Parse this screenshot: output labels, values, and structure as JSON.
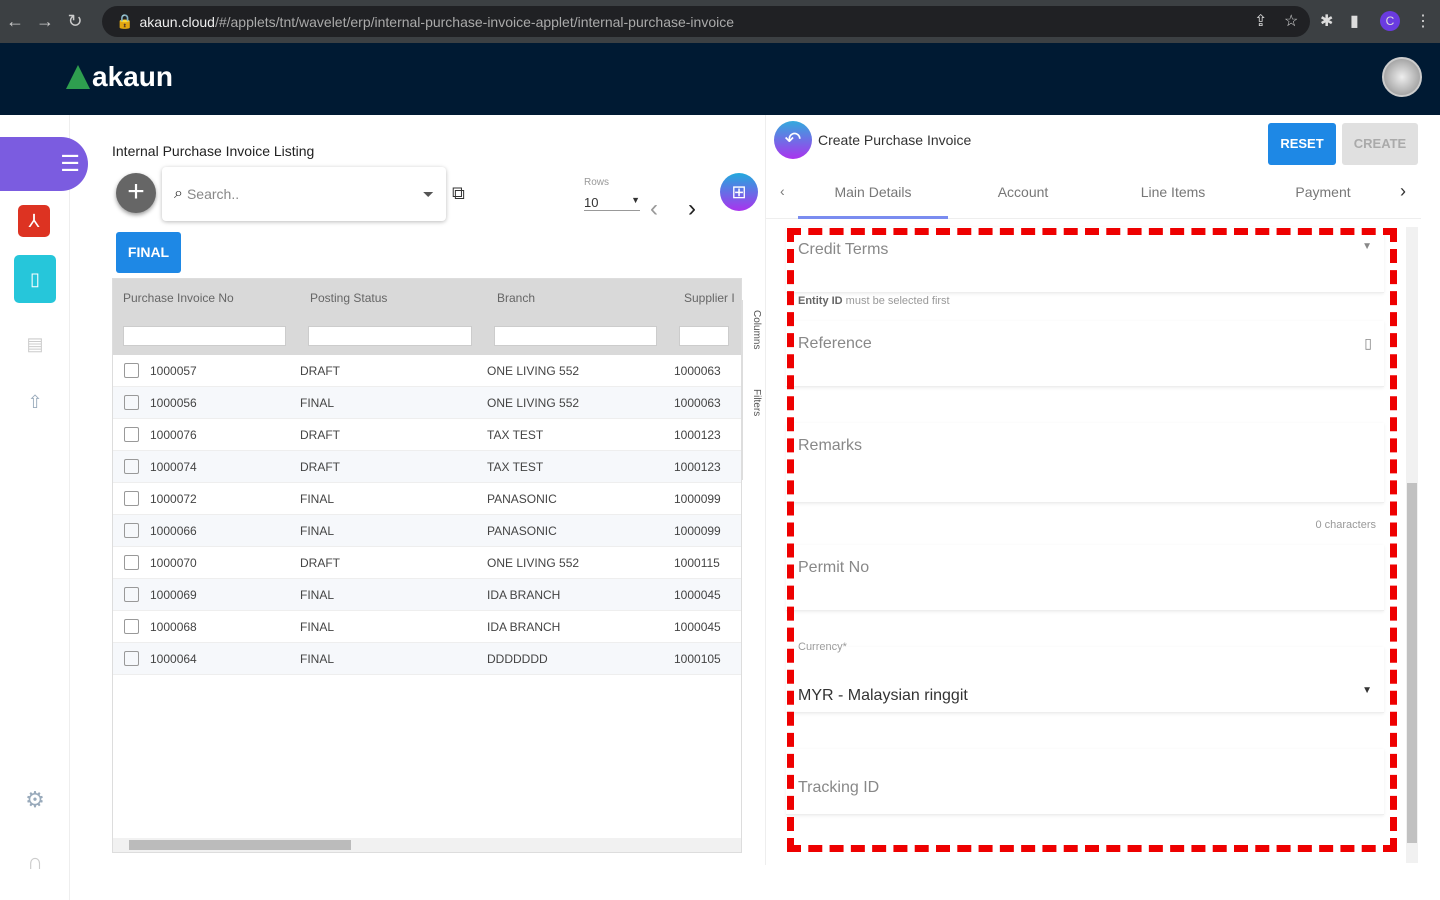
{
  "browser": {
    "url_domain": "akaun.cloud",
    "url_path": "/#/applets/tnt/wavelet/erp/internal-purchase-invoice-applet/internal-purchase-invoice",
    "profile_initial": "C"
  },
  "app": {
    "logo": "akaun"
  },
  "listing": {
    "title": "Internal Purchase Invoice Listing",
    "search_placeholder": "Search..",
    "rows_label": "Rows",
    "rows_value": "10",
    "final_button": "FINAL",
    "columns": [
      "Purchase Invoice No",
      "Posting Status",
      "Branch",
      "Supplier ID"
    ],
    "side_tools": {
      "columns": "Columns",
      "filters": "Filters"
    },
    "rows": [
      [
        "1000057",
        "DRAFT",
        "ONE LIVING 552",
        "1000063"
      ],
      [
        "1000056",
        "FINAL",
        "ONE LIVING 552",
        "1000063"
      ],
      [
        "1000076",
        "DRAFT",
        "TAX TEST",
        "1000123"
      ],
      [
        "1000074",
        "DRAFT",
        "TAX TEST",
        "1000123"
      ],
      [
        "1000072",
        "FINAL",
        "PANASONIC",
        "1000099"
      ],
      [
        "1000066",
        "FINAL",
        "PANASONIC",
        "1000099"
      ],
      [
        "1000070",
        "DRAFT",
        "ONE LIVING 552",
        "1000115"
      ],
      [
        "1000069",
        "FINAL",
        "IDA BRANCH",
        "1000045"
      ],
      [
        "1000068",
        "FINAL",
        "IDA BRANCH",
        "1000045"
      ],
      [
        "1000064",
        "FINAL",
        "DDDDDDD",
        "1000105"
      ]
    ]
  },
  "form": {
    "title": "Create Purchase Invoice",
    "reset": "RESET",
    "create": "CREATE",
    "tabs": [
      "Main Details",
      "Account",
      "Line Items",
      "Payment"
    ],
    "credit_terms": "Credit Terms",
    "entity_hint_bold": "Entity ID",
    "entity_hint": " must be selected first",
    "reference": "Reference",
    "remarks": "Remarks",
    "char_count": "0 characters",
    "permit_no": "Permit No",
    "currency_label": "Currency*",
    "currency_value": "MYR - Malaysian ringgit",
    "tracking_id": "Tracking ID"
  }
}
